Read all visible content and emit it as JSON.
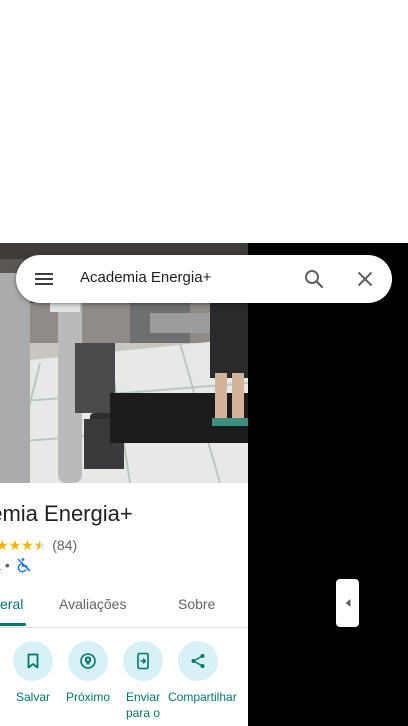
{
  "search": {
    "query": "Academia Energia+",
    "menu_icon": "menu-icon",
    "search_icon": "search-icon",
    "close_icon": "close-icon"
  },
  "place": {
    "name": "Academia Energia+",
    "name_visible": "demia Energia+",
    "rating": 4.5,
    "review_count": "(84)",
    "category_visible": "ia",
    "separator": "•",
    "accessibility_icon": "no-wheelchair-icon"
  },
  "tabs": [
    {
      "label": "eral",
      "active": true
    },
    {
      "label": "Avaliações",
      "active": false
    },
    {
      "label": "Sobre",
      "active": false
    }
  ],
  "actions": [
    {
      "label": "Salvar",
      "icon": "bookmark-icon"
    },
    {
      "label": "Próximo",
      "icon": "nearby-icon"
    },
    {
      "label": "Enviar para o",
      "icon": "send-to-phone-icon"
    },
    {
      "label": "Compartilhar",
      "icon": "share-icon"
    }
  ],
  "colors": {
    "accent": "#00796b",
    "action_bg": "#d7f1f7",
    "star": "#f4b400",
    "map_bg": "#000000"
  },
  "collapse_icon": "chevron-left-icon"
}
